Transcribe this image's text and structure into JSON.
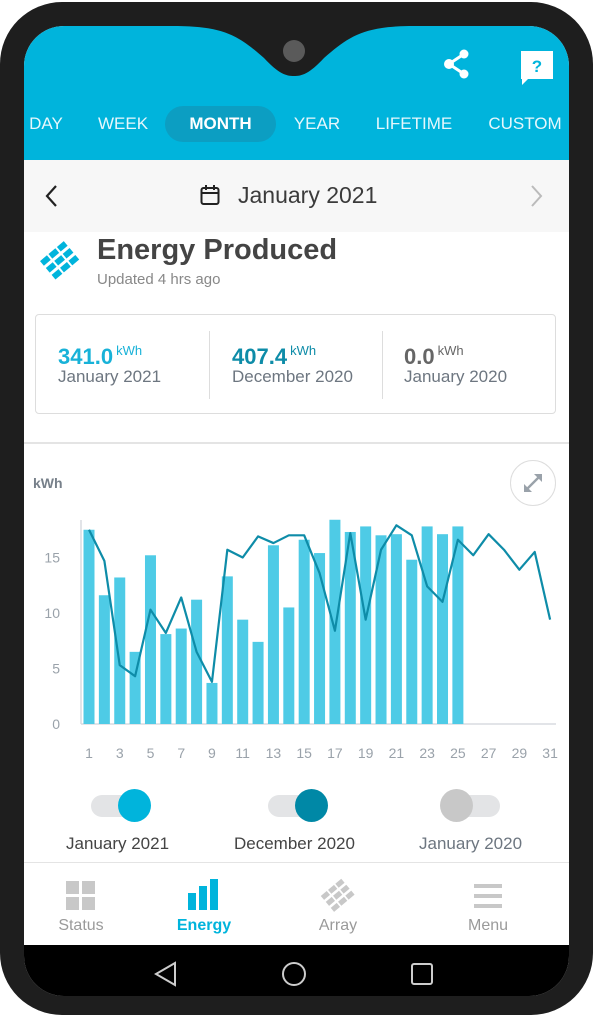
{
  "header": {
    "share_icon": "share-icon",
    "help_icon": "help-chat-icon",
    "tabs": [
      {
        "label": "DAY",
        "active": false
      },
      {
        "label": "WEEK",
        "active": false
      },
      {
        "label": "MONTH",
        "active": true
      },
      {
        "label": "YEAR",
        "active": false
      },
      {
        "label": "LIFETIME",
        "active": false
      },
      {
        "label": "CUSTOM",
        "active": false
      }
    ]
  },
  "date_nav": {
    "prev_icon": "chevron-left-icon",
    "calendar_icon": "calendar-icon",
    "label": "January 2021",
    "next_icon": "chevron-right-icon"
  },
  "section": {
    "icon": "solar-array-icon",
    "title": "Energy Produced",
    "subtitle": "Updated 4 hrs ago"
  },
  "summary": [
    {
      "value": "341.0",
      "unit": "kWh",
      "label": "January 2021",
      "color": "#18b2d8"
    },
    {
      "value": "407.4",
      "unit": "kWh",
      "label": "December 2020",
      "color": "#0e8ca8"
    },
    {
      "value": "0.0",
      "unit": "kWh",
      "label": "January 2020",
      "color": "#666666"
    }
  ],
  "chart": {
    "unit_label": "kWh",
    "expand_icon": "expand-icon"
  },
  "chart_data": {
    "type": "bar",
    "title": "Energy Produced",
    "xlabel": "",
    "ylabel": "kWh",
    "ylim": [
      0,
      18.5
    ],
    "yticks": [
      0,
      5,
      10,
      15
    ],
    "x": [
      1,
      2,
      3,
      4,
      5,
      6,
      7,
      8,
      9,
      10,
      11,
      12,
      13,
      14,
      15,
      16,
      17,
      18,
      19,
      20,
      21,
      22,
      23,
      24,
      25,
      26,
      27,
      28,
      29,
      30,
      31
    ],
    "xtick_labels": [
      "1",
      "3",
      "5",
      "7",
      "9",
      "11",
      "13",
      "15",
      "17",
      "19",
      "21",
      "23",
      "25",
      "27",
      "29",
      "31"
    ],
    "grid": false,
    "series": [
      {
        "name": "January 2021",
        "type": "bar",
        "color": "#4ecbe6",
        "values": [
          17.5,
          11.6,
          13.2,
          6.5,
          15.2,
          8.1,
          8.6,
          11.2,
          3.7,
          13.3,
          9.4,
          7.4,
          16.1,
          10.5,
          16.6,
          15.4,
          18.4,
          17.3,
          17.8,
          17.0,
          17.1,
          14.8,
          17.8,
          17.1,
          17.8
        ]
      },
      {
        "name": "December 2020",
        "type": "line",
        "color": "#0e8ca8",
        "values": [
          17.5,
          14.7,
          5.3,
          4.3,
          10.3,
          8.2,
          11.4,
          6.5,
          3.8,
          15.7,
          15.0,
          16.9,
          16.3,
          17.0,
          17.0,
          13.6,
          8.4,
          17.2,
          9.4,
          15.7,
          17.9,
          17.0,
          12.4,
          11.0,
          16.6,
          15.2,
          17.1,
          15.7,
          13.9,
          15.5,
          9.4
        ]
      },
      {
        "name": "January 2020",
        "type": "line",
        "color": "#c8c8c8",
        "values": []
      }
    ]
  },
  "legend_toggles": [
    {
      "label": "January 2021",
      "on": true,
      "color": "#00b4dc",
      "label_color": "#444444"
    },
    {
      "label": "December 2020",
      "on": true,
      "color": "#0088a6",
      "label_color": "#444444"
    },
    {
      "label": "January 2020",
      "on": false,
      "color": "#c8c8c8",
      "label_color": "#6d7680"
    }
  ],
  "bottom_nav": [
    {
      "label": "Status",
      "icon": "status-grid-icon",
      "active": false
    },
    {
      "label": "Energy",
      "icon": "energy-bars-icon",
      "active": true
    },
    {
      "label": "Array",
      "icon": "solar-array-icon",
      "active": false
    },
    {
      "label": "Menu",
      "icon": "hamburger-menu-icon",
      "active": false
    }
  ],
  "system_nav": {
    "back_icon": "back-triangle-icon",
    "home_icon": "home-circle-icon",
    "recents_icon": "recents-square-icon"
  }
}
